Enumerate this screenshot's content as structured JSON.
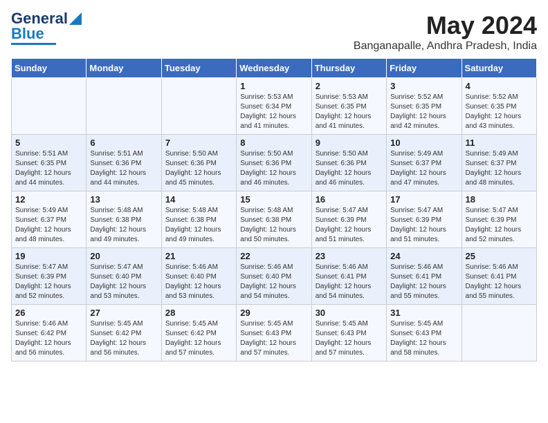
{
  "header": {
    "logo_line1": "General",
    "logo_line2": "Blue",
    "month": "May 2024",
    "location": "Banganapalle, Andhra Pradesh, India"
  },
  "weekdays": [
    "Sunday",
    "Monday",
    "Tuesday",
    "Wednesday",
    "Thursday",
    "Friday",
    "Saturday"
  ],
  "weeks": [
    [
      {
        "day": "",
        "info": ""
      },
      {
        "day": "",
        "info": ""
      },
      {
        "day": "",
        "info": ""
      },
      {
        "day": "1",
        "info": "Sunrise: 5:53 AM\nSunset: 6:34 PM\nDaylight: 12 hours\nand 41 minutes."
      },
      {
        "day": "2",
        "info": "Sunrise: 5:53 AM\nSunset: 6:35 PM\nDaylight: 12 hours\nand 41 minutes."
      },
      {
        "day": "3",
        "info": "Sunrise: 5:52 AM\nSunset: 6:35 PM\nDaylight: 12 hours\nand 42 minutes."
      },
      {
        "day": "4",
        "info": "Sunrise: 5:52 AM\nSunset: 6:35 PM\nDaylight: 12 hours\nand 43 minutes."
      }
    ],
    [
      {
        "day": "5",
        "info": "Sunrise: 5:51 AM\nSunset: 6:35 PM\nDaylight: 12 hours\nand 44 minutes."
      },
      {
        "day": "6",
        "info": "Sunrise: 5:51 AM\nSunset: 6:36 PM\nDaylight: 12 hours\nand 44 minutes."
      },
      {
        "day": "7",
        "info": "Sunrise: 5:50 AM\nSunset: 6:36 PM\nDaylight: 12 hours\nand 45 minutes."
      },
      {
        "day": "8",
        "info": "Sunrise: 5:50 AM\nSunset: 6:36 PM\nDaylight: 12 hours\nand 46 minutes."
      },
      {
        "day": "9",
        "info": "Sunrise: 5:50 AM\nSunset: 6:36 PM\nDaylight: 12 hours\nand 46 minutes."
      },
      {
        "day": "10",
        "info": "Sunrise: 5:49 AM\nSunset: 6:37 PM\nDaylight: 12 hours\nand 47 minutes."
      },
      {
        "day": "11",
        "info": "Sunrise: 5:49 AM\nSunset: 6:37 PM\nDaylight: 12 hours\nand 48 minutes."
      }
    ],
    [
      {
        "day": "12",
        "info": "Sunrise: 5:49 AM\nSunset: 6:37 PM\nDaylight: 12 hours\nand 48 minutes."
      },
      {
        "day": "13",
        "info": "Sunrise: 5:48 AM\nSunset: 6:38 PM\nDaylight: 12 hours\nand 49 minutes."
      },
      {
        "day": "14",
        "info": "Sunrise: 5:48 AM\nSunset: 6:38 PM\nDaylight: 12 hours\nand 49 minutes."
      },
      {
        "day": "15",
        "info": "Sunrise: 5:48 AM\nSunset: 6:38 PM\nDaylight: 12 hours\nand 50 minutes."
      },
      {
        "day": "16",
        "info": "Sunrise: 5:47 AM\nSunset: 6:39 PM\nDaylight: 12 hours\nand 51 minutes."
      },
      {
        "day": "17",
        "info": "Sunrise: 5:47 AM\nSunset: 6:39 PM\nDaylight: 12 hours\nand 51 minutes."
      },
      {
        "day": "18",
        "info": "Sunrise: 5:47 AM\nSunset: 6:39 PM\nDaylight: 12 hours\nand 52 minutes."
      }
    ],
    [
      {
        "day": "19",
        "info": "Sunrise: 5:47 AM\nSunset: 6:39 PM\nDaylight: 12 hours\nand 52 minutes."
      },
      {
        "day": "20",
        "info": "Sunrise: 5:47 AM\nSunset: 6:40 PM\nDaylight: 12 hours\nand 53 minutes."
      },
      {
        "day": "21",
        "info": "Sunrise: 5:46 AM\nSunset: 6:40 PM\nDaylight: 12 hours\nand 53 minutes."
      },
      {
        "day": "22",
        "info": "Sunrise: 5:46 AM\nSunset: 6:40 PM\nDaylight: 12 hours\nand 54 minutes."
      },
      {
        "day": "23",
        "info": "Sunrise: 5:46 AM\nSunset: 6:41 PM\nDaylight: 12 hours\nand 54 minutes."
      },
      {
        "day": "24",
        "info": "Sunrise: 5:46 AM\nSunset: 6:41 PM\nDaylight: 12 hours\nand 55 minutes."
      },
      {
        "day": "25",
        "info": "Sunrise: 5:46 AM\nSunset: 6:41 PM\nDaylight: 12 hours\nand 55 minutes."
      }
    ],
    [
      {
        "day": "26",
        "info": "Sunrise: 5:46 AM\nSunset: 6:42 PM\nDaylight: 12 hours\nand 56 minutes."
      },
      {
        "day": "27",
        "info": "Sunrise: 5:45 AM\nSunset: 6:42 PM\nDaylight: 12 hours\nand 56 minutes."
      },
      {
        "day": "28",
        "info": "Sunrise: 5:45 AM\nSunset: 6:42 PM\nDaylight: 12 hours\nand 57 minutes."
      },
      {
        "day": "29",
        "info": "Sunrise: 5:45 AM\nSunset: 6:43 PM\nDaylight: 12 hours\nand 57 minutes."
      },
      {
        "day": "30",
        "info": "Sunrise: 5:45 AM\nSunset: 6:43 PM\nDaylight: 12 hours\nand 57 minutes."
      },
      {
        "day": "31",
        "info": "Sunrise: 5:45 AM\nSunset: 6:43 PM\nDaylight: 12 hours\nand 58 minutes."
      },
      {
        "day": "",
        "info": ""
      }
    ]
  ]
}
